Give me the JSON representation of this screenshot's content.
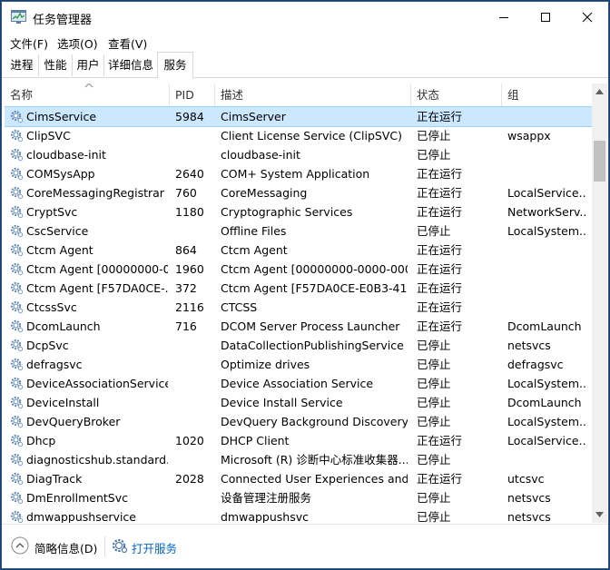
{
  "window": {
    "title": "任务管理器"
  },
  "menu": [
    "文件(F)",
    "选项(O)",
    "查看(V)"
  ],
  "tabs": [
    {
      "label": "进程",
      "active": false
    },
    {
      "label": "性能",
      "active": false
    },
    {
      "label": "用户",
      "active": false
    },
    {
      "label": "详细信息",
      "active": false
    },
    {
      "label": "服务",
      "active": true
    }
  ],
  "columns": {
    "name": "名称",
    "pid": "PID",
    "desc": "描述",
    "status": "状态",
    "group": "组"
  },
  "rows": [
    {
      "name": "CimsService",
      "pid": "5984",
      "desc": "CimsServer",
      "status": "正在运行",
      "group": "",
      "selected": true
    },
    {
      "name": "ClipSVC",
      "pid": "",
      "desc": "Client License Service (ClipSVC)",
      "status": "已停止",
      "group": "wsappx"
    },
    {
      "name": "cloudbase-init",
      "pid": "",
      "desc": "cloudbase-init",
      "status": "已停止",
      "group": ""
    },
    {
      "name": "COMSysApp",
      "pid": "2640",
      "desc": "COM+ System Application",
      "status": "正在运行",
      "group": ""
    },
    {
      "name": "CoreMessagingRegistrar",
      "pid": "760",
      "desc": "CoreMessaging",
      "status": "正在运行",
      "group": "LocalService..."
    },
    {
      "name": "CryptSvc",
      "pid": "1180",
      "desc": "Cryptographic Services",
      "status": "正在运行",
      "group": "NetworkServ..."
    },
    {
      "name": "CscService",
      "pid": "",
      "desc": "Offline Files",
      "status": "已停止",
      "group": "LocalSystem..."
    },
    {
      "name": "Ctcm Agent",
      "pid": "864",
      "desc": "Ctcm Agent",
      "status": "正在运行",
      "group": ""
    },
    {
      "name": "Ctcm Agent [00000000-0...",
      "pid": "1960",
      "desc": "Ctcm Agent [00000000-0000-000...",
      "status": "正在运行",
      "group": ""
    },
    {
      "name": "Ctcm Agent [F57DA0CE-...",
      "pid": "372",
      "desc": "Ctcm Agent [F57DA0CE-E0B3-41...",
      "status": "正在运行",
      "group": ""
    },
    {
      "name": "CtcssSvc",
      "pid": "2116",
      "desc": "CTCSS",
      "status": "正在运行",
      "group": ""
    },
    {
      "name": "DcomLaunch",
      "pid": "716",
      "desc": "DCOM Server Process Launcher",
      "status": "正在运行",
      "group": "DcomLaunch"
    },
    {
      "name": "DcpSvc",
      "pid": "",
      "desc": "DataCollectionPublishingService",
      "status": "已停止",
      "group": "netsvcs"
    },
    {
      "name": "defragsvc",
      "pid": "",
      "desc": "Optimize drives",
      "status": "已停止",
      "group": "defragsvc"
    },
    {
      "name": "DeviceAssociationService",
      "pid": "",
      "desc": "Device Association Service",
      "status": "已停止",
      "group": "LocalSystem..."
    },
    {
      "name": "DeviceInstall",
      "pid": "",
      "desc": "Device Install Service",
      "status": "已停止",
      "group": "DcomLaunch"
    },
    {
      "name": "DevQueryBroker",
      "pid": "",
      "desc": "DevQuery Background Discovery...",
      "status": "已停止",
      "group": "LocalSystem..."
    },
    {
      "name": "Dhcp",
      "pid": "1020",
      "desc": "DHCP Client",
      "status": "正在运行",
      "group": "LocalService..."
    },
    {
      "name": "diagnosticshub.standard...",
      "pid": "",
      "desc": "Microsoft (R) 诊断中心标准收集器...",
      "status": "已停止",
      "group": ""
    },
    {
      "name": "DiagTrack",
      "pid": "2028",
      "desc": "Connected User Experiences and...",
      "status": "正在运行",
      "group": "utcsvc"
    },
    {
      "name": "DmEnrollmentSvc",
      "pid": "",
      "desc": "设备管理注册服务",
      "status": "已停止",
      "group": "netsvcs"
    },
    {
      "name": "dmwappushservice",
      "pid": "",
      "desc": "dmwappushsvc",
      "status": "已停止",
      "group": "netsvcs"
    }
  ],
  "footer": {
    "brief": "简略信息(D)",
    "open_services": "打开服务"
  },
  "colors": {
    "selected_bg": "#cce8ff",
    "link": "#0066cc"
  }
}
